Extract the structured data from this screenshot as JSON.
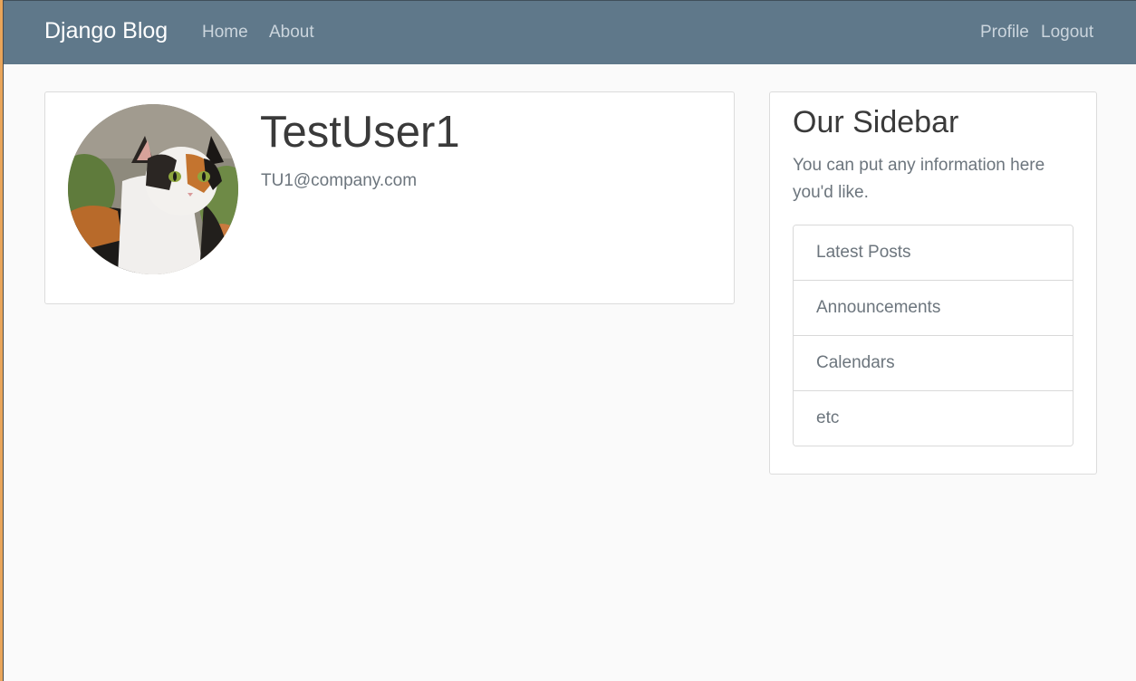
{
  "navbar": {
    "brand": "Django Blog",
    "links": [
      {
        "label": "Home"
      },
      {
        "label": "About"
      }
    ],
    "right_links": [
      {
        "label": "Profile"
      },
      {
        "label": "Logout"
      }
    ]
  },
  "profile": {
    "username": "TestUser1",
    "email": "TU1@company.com",
    "avatar_icon": "cat-photo"
  },
  "sidebar": {
    "title": "Our Sidebar",
    "description": "You can put any information here you'd like.",
    "items": [
      {
        "label": "Latest Posts"
      },
      {
        "label": "Announcements"
      },
      {
        "label": "Calendars"
      },
      {
        "label": "etc"
      }
    ]
  },
  "colors": {
    "navbar_bg": "#5f788a",
    "page_bg": "#fafafa",
    "muted_text": "#6c757d",
    "heading_text": "#3a3a3a"
  }
}
